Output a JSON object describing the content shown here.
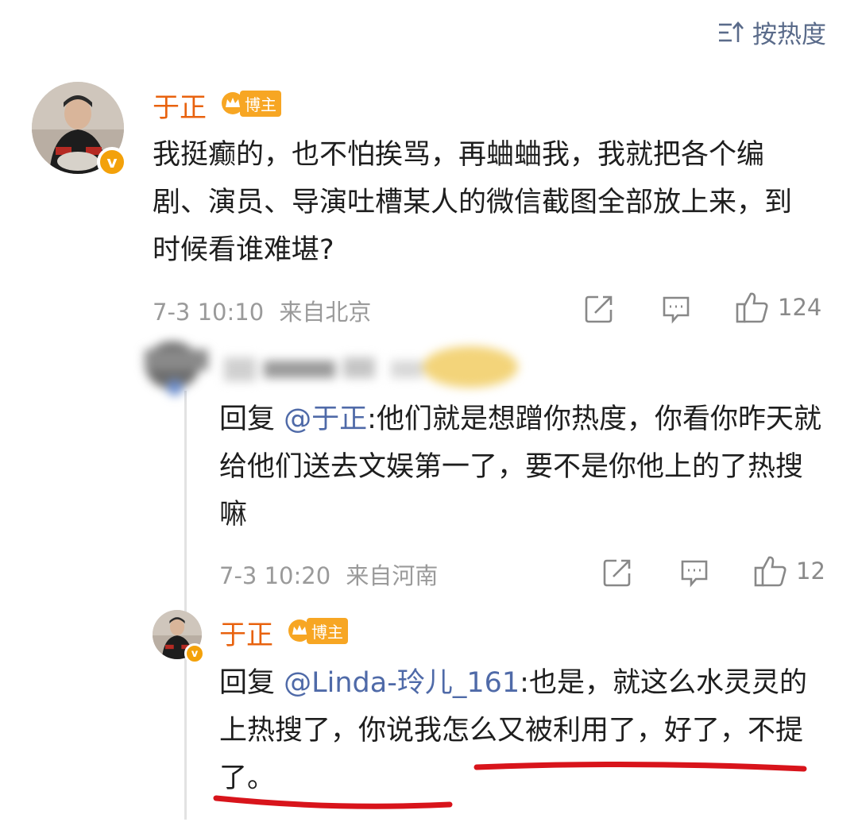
{
  "sort": {
    "label": "按热度",
    "icon": "sort-icon"
  },
  "comment": {
    "author": "于正",
    "badge": "博主",
    "text": "我挺癫的，也不怕挨骂，再蛐蛐我，我就把各个编剧、演员、导演吐槽某人的微信截图全部放上来，到时候看谁难堪?",
    "time": "7-3 10:10",
    "location": "来自北京",
    "likes": "124"
  },
  "replies": [
    {
      "author": "",
      "reply_prefix": "回复 ",
      "reply_to": "@于正",
      "text": ":他们就是想蹭你热度，你看你昨天就给他们送去文娱第一了，要不是你他上的了热搜嘛",
      "time": "7-3 10:20",
      "location": "来自河南",
      "likes": "12"
    },
    {
      "author": "于正",
      "badge": "博主",
      "reply_prefix": "回复 ",
      "reply_to": "@Linda-玲儿_161",
      "text": ":也是，就这么水灵灵的上热搜了，你说我怎么又被利用了，好了，不提了。"
    }
  ],
  "colors": {
    "accent": "#e8620e",
    "link": "#4f6aa8",
    "badge": "#f7a623",
    "annotation": "#d8141b"
  }
}
